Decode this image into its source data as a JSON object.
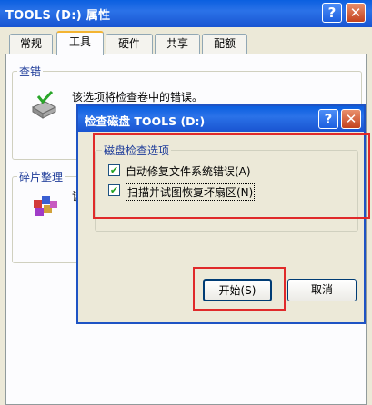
{
  "back_window": {
    "title": "TOOLS (D:) 属性",
    "tabs": [
      "常规",
      "工具",
      "硬件",
      "共享",
      "配额"
    ],
    "active_tab": "工具",
    "error_check": {
      "group_label": "查错",
      "description": "该选项将检查卷中的错误。"
    },
    "defrag": {
      "group_label": "碎片整理",
      "description_partial": "该"
    }
  },
  "dialog": {
    "title": "检查磁盘 TOOLS (D:)",
    "options_group_label": "磁盘检查选项",
    "options": [
      {
        "label": "自动修复文件系统错误(A)",
        "checked": true
      },
      {
        "label": "扫描并试图恢复坏扇区(N)",
        "checked": true
      }
    ],
    "start_button": "开始(S)",
    "cancel_button": "取消"
  },
  "caption_buttons": {
    "help": "?",
    "close": "✕"
  },
  "colors": {
    "titlebar": "#0b5fe0",
    "highlight_box": "#e02a2a",
    "group_label": "#1f3d9a"
  }
}
